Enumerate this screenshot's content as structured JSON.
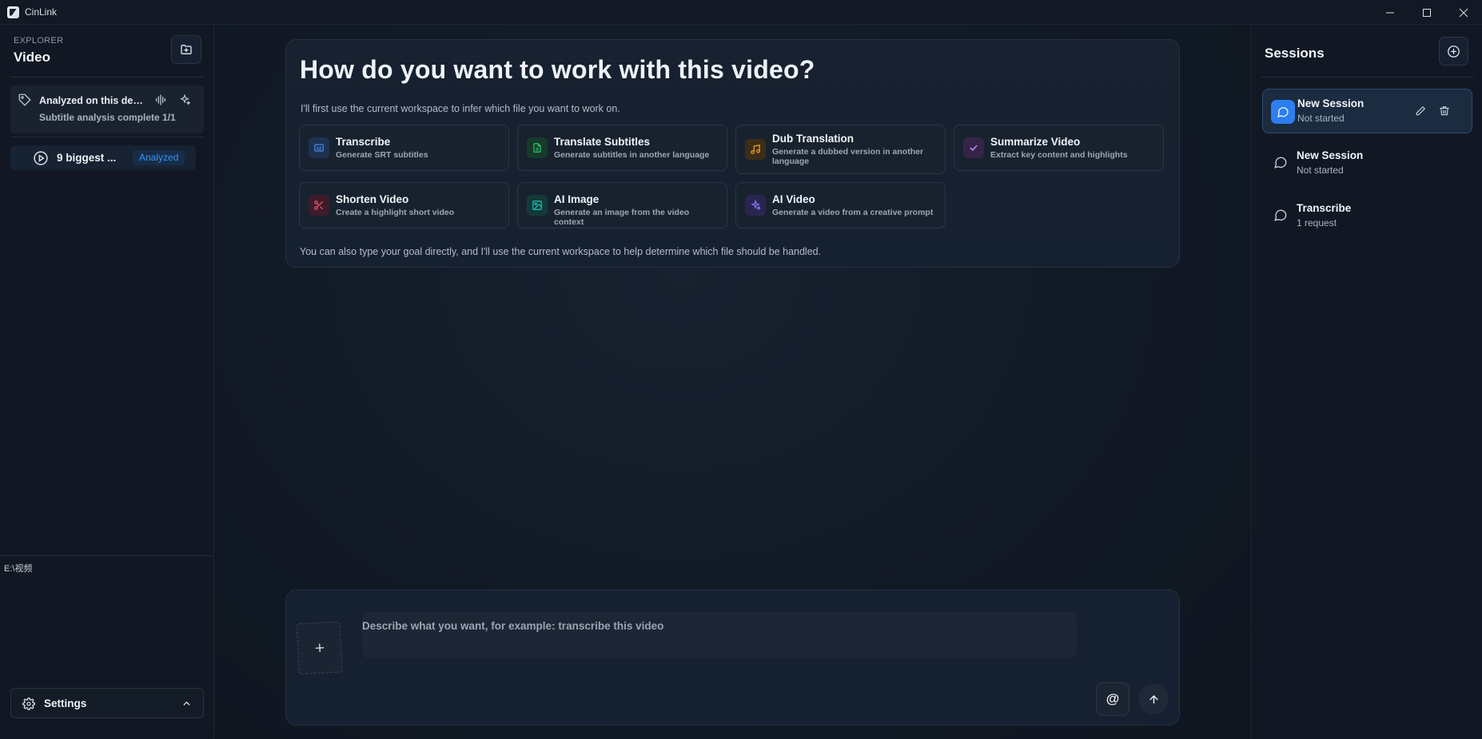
{
  "window": {
    "title": "CinLink"
  },
  "sidebar": {
    "explorer_label": "EXPLORER",
    "folder_title": "Video",
    "analysis": {
      "title": "Analyzed on this dev...",
      "subtitle": "Subtitle analysis complete 1/1"
    },
    "files": [
      {
        "name": "9 biggest ...",
        "badge": "Analyzed"
      }
    ],
    "path": "E:\\视频",
    "settings_label": "Settings"
  },
  "welcome": {
    "title": "How do you want to work with this video?",
    "subtitle": "I'll first use the current workspace to infer which file you want to work on.",
    "footer": "You can also type your goal directly, and I'll use the current workspace to help determine which file should be handled.",
    "actions": [
      {
        "title": "Transcribe",
        "desc": "Generate SRT subtitles",
        "icon": "subtitles-icon",
        "color": "#3b82f6"
      },
      {
        "title": "Translate Subtitles",
        "desc": "Generate subtitles in another language",
        "icon": "document-icon",
        "color": "#22c55e"
      },
      {
        "title": "Dub Translation",
        "desc": "Generate a dubbed version in another language",
        "icon": "music-note-icon",
        "color": "#f59e0b"
      },
      {
        "title": "Summarize Video",
        "desc": "Extract key content and highlights",
        "icon": "check-icon",
        "color": "#c084fc"
      },
      {
        "title": "Shorten Video",
        "desc": "Create a highlight short video",
        "icon": "scissors-icon",
        "color": "#f43f5e"
      },
      {
        "title": "AI Image",
        "desc": "Generate an image from the video context",
        "icon": "image-icon",
        "color": "#14b8a6"
      },
      {
        "title": "AI Video",
        "desc": "Generate a video from a creative prompt",
        "icon": "sparkle-icon",
        "color": "#8b5cf6"
      }
    ]
  },
  "composer": {
    "placeholder": "Describe what you want, for example: transcribe this video",
    "mention_label": "@"
  },
  "sessions": {
    "title": "Sessions",
    "items": [
      {
        "title": "New Session",
        "status": "Not started",
        "active": true
      },
      {
        "title": "New Session",
        "status": "Not started",
        "active": false
      },
      {
        "title": "Transcribe",
        "status": "1 request",
        "active": false
      }
    ]
  }
}
